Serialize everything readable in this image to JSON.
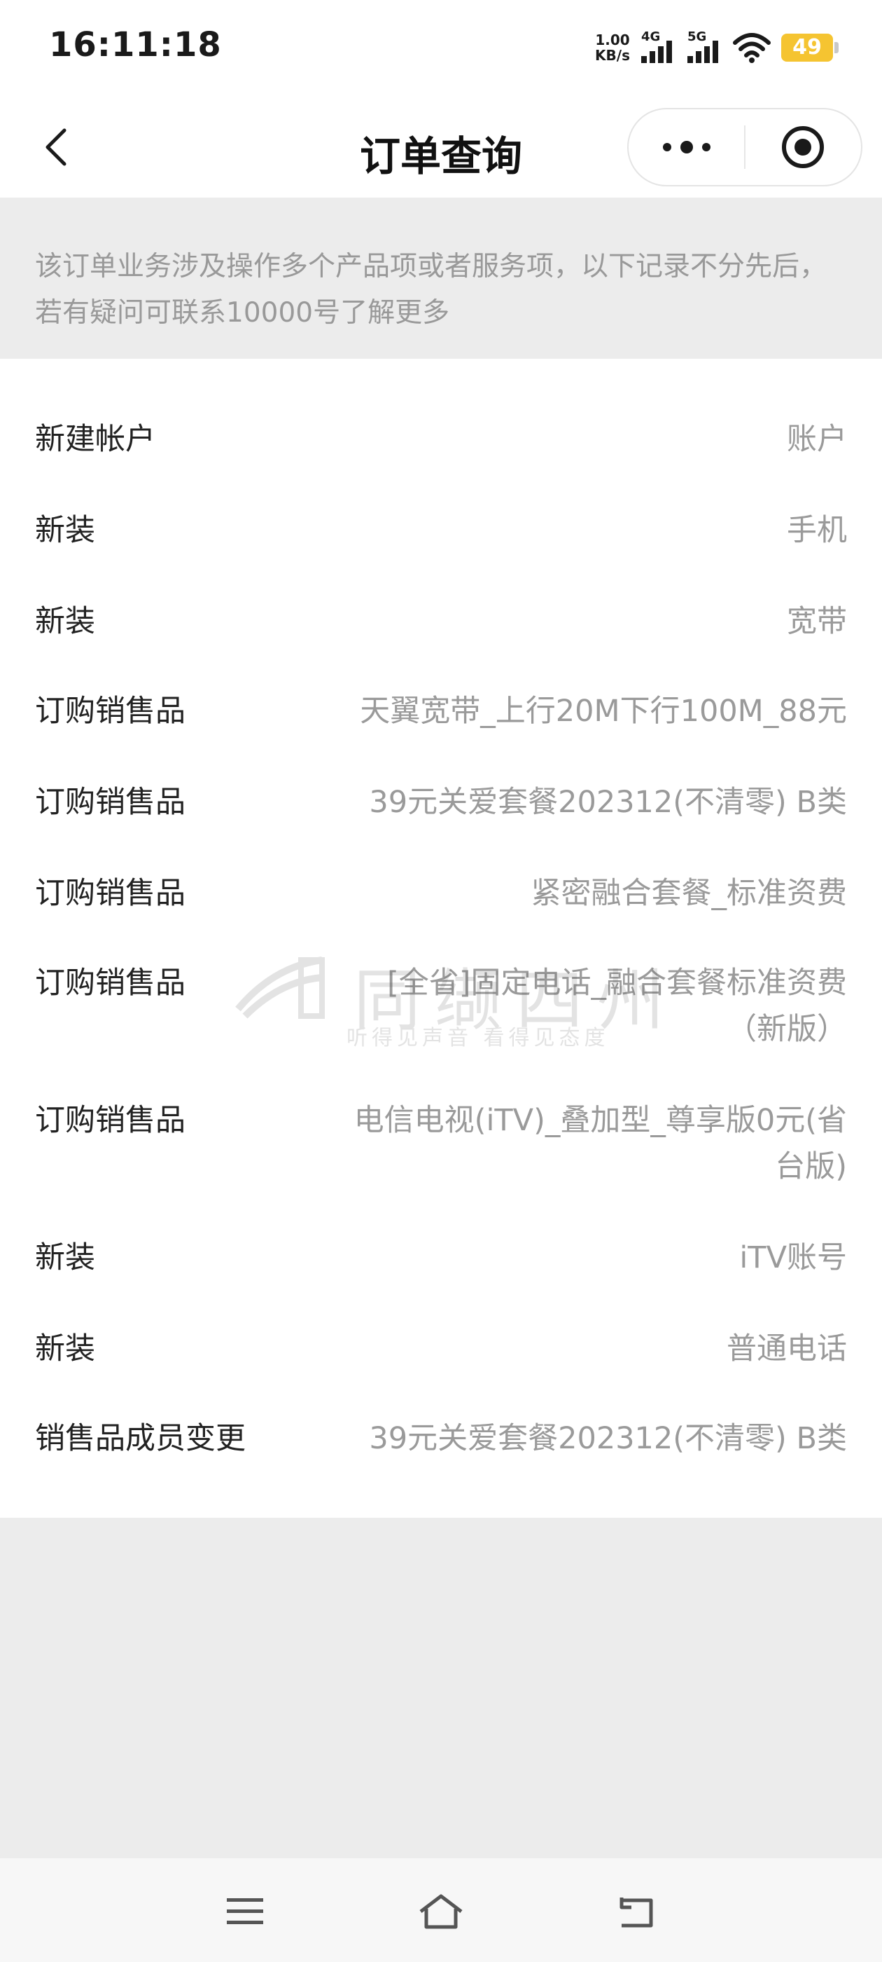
{
  "status_bar": {
    "time": "16:11:18",
    "net_speed_value": "1.00",
    "net_speed_unit": "KB/s",
    "signal_1_gen": "4G",
    "signal_2_gen": "5G",
    "battery_level": "49"
  },
  "nav": {
    "title": "订单查询"
  },
  "notice": {
    "text": "该订单业务涉及操作多个产品项或者服务项，以下记录不分先后，若有疑问可联系10000号了解更多"
  },
  "orders": [
    {
      "label": "新建帐户",
      "value": "账户"
    },
    {
      "label": "新装",
      "value": "手机"
    },
    {
      "label": "新装",
      "value": "宽带"
    },
    {
      "label": "订购销售品",
      "value": "天翼宽带_上行20M下行100M_88元"
    },
    {
      "label": "订购销售品",
      "value": "39元关爱套餐202312(不清零) B类"
    },
    {
      "label": "订购销售品",
      "value": "紧密融合套餐_标准资费"
    },
    {
      "label": "订购销售品",
      "value": "[全省]固定电话_融合套餐标准资费（新版）"
    },
    {
      "label": "订购销售品",
      "value": "电信电视(iTV)_叠加型_尊享版0元(省台版)"
    },
    {
      "label": "新装",
      "value": "iTV账号"
    },
    {
      "label": "新装",
      "value": "普通电话"
    },
    {
      "label": "销售品成员变更",
      "value": "39元关爱套餐202312(不清零) B类"
    }
  ],
  "watermark": {
    "main": "同缬四州",
    "sub": "听得见声音  看得见态度"
  },
  "icons": {
    "back": "chevron-left-icon",
    "more": "more-dots-icon",
    "close": "target-circle-icon",
    "menu": "menu-icon",
    "home": "home-icon",
    "return": "return-icon"
  }
}
